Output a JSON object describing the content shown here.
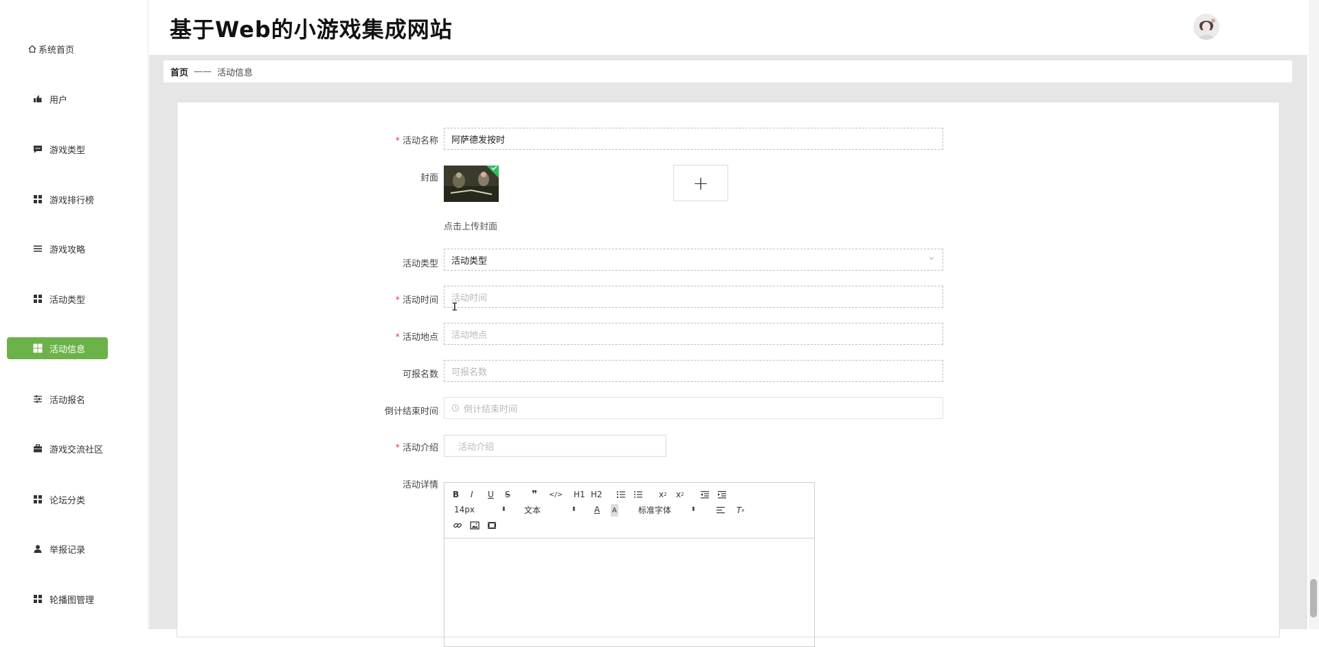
{
  "site": {
    "title": "基于Web的小游戏集成网站"
  },
  "sidebar": {
    "items": [
      {
        "label": "系统首页",
        "icon": "home-icon"
      },
      {
        "label": "用户",
        "icon": "thumb-icon"
      },
      {
        "label": "游戏类型",
        "icon": "chat-icon"
      },
      {
        "label": "游戏排行榜",
        "icon": "grid-icon"
      },
      {
        "label": "游戏攻略",
        "icon": "list-icon"
      },
      {
        "label": "活动类型",
        "icon": "grid-icon"
      },
      {
        "label": "活动信息",
        "icon": "grid-icon",
        "active": true
      },
      {
        "label": "活动报名",
        "icon": "sliders-icon"
      },
      {
        "label": "游戏交流社区",
        "icon": "briefcase-icon"
      },
      {
        "label": "论坛分类",
        "icon": "grid-icon"
      },
      {
        "label": "举报记录",
        "icon": "user-icon"
      },
      {
        "label": "轮播图管理",
        "icon": "grid-icon"
      }
    ],
    "active_color": "#6cb24a"
  },
  "breadcrumb": {
    "home": "首页",
    "separator": "——",
    "current": "活动信息"
  },
  "form": {
    "name": {
      "label": "活动名称",
      "value": "阿萨德发按时"
    },
    "cover": {
      "label": "封面",
      "tip": "点击上传封面",
      "add": "+"
    },
    "type": {
      "label": "活动类型",
      "value": "活动类型"
    },
    "time": {
      "label": "活动时间",
      "placeholder": "活动时间"
    },
    "place": {
      "label": "活动地点",
      "placeholder": "活动地点"
    },
    "quota": {
      "label": "可报名数",
      "placeholder": "可报名数"
    },
    "countdown": {
      "label": "倒计结束时间",
      "placeholder": "倒计结束时间"
    },
    "intro": {
      "label": "活动介绍",
      "placeholder": "活动介绍"
    },
    "detail": {
      "label": "活动详情"
    },
    "required_mark": "*"
  },
  "editor": {
    "font_size": "14px",
    "paragraph": "文本",
    "font_family": "标准字体",
    "h1": "H1",
    "h2": "H2"
  }
}
